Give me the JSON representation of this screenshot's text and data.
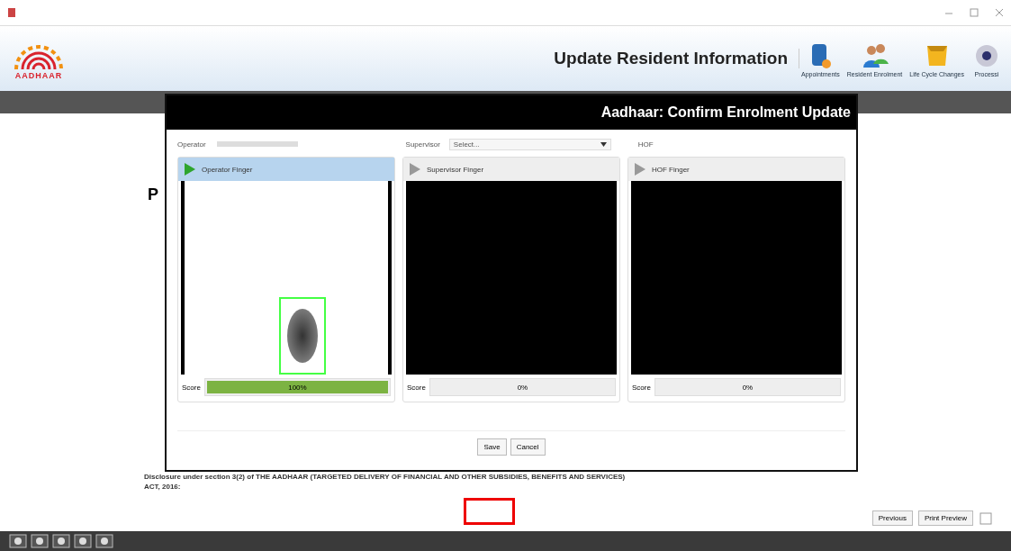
{
  "header": {
    "logo": "AADHAAR",
    "title": "Update Resident Information",
    "toolbar": [
      {
        "label": "Appointments",
        "kind": "database"
      },
      {
        "label": "Resident Enrolment",
        "kind": "people"
      },
      {
        "label": "Life Cycle Changes",
        "kind": "box"
      },
      {
        "label": "Processi",
        "kind": "disc"
      }
    ]
  },
  "background": {
    "heading": "P",
    "disclosure": "Disclosure under section 3(2) of THE AADHAAR (TARGETED DELIVERY OF FINANCIAL AND OTHER SUBSIDIES, BENEFITS AND SERVICES) ACT, 2016:",
    "buttons": [
      "Previous",
      "Print Preview"
    ]
  },
  "dialog": {
    "title": "Aadhaar: Confirm Enrolment Update",
    "operator_label": "Operator",
    "supervisor_label": "Supervisor",
    "supervisor_placeholder": "Select...",
    "hof_label": "HOF",
    "panels": [
      {
        "title": "Operator Finger",
        "selected": true,
        "captured": true,
        "score_label": "Score",
        "score": "100%",
        "level": 1
      },
      {
        "title": "Supervisor Finger",
        "selected": false,
        "captured": false,
        "score_label": "Score",
        "score": "0%",
        "level": 0
      },
      {
        "title": "HOF Finger",
        "selected": false,
        "captured": false,
        "score_label": "Score",
        "score": "0%",
        "level": 0
      }
    ],
    "buttons": [
      "Save",
      "Cancel"
    ]
  },
  "annotation": {
    "highlight": true
  }
}
